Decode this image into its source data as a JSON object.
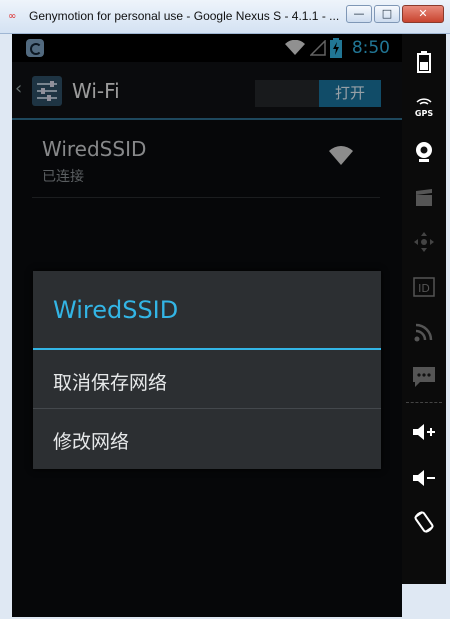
{
  "window": {
    "title": "Genymotion for personal use - Google Nexus S - 4.1.1 - ...",
    "controls": {
      "minimize": "—",
      "maximize": "□",
      "close": "✕"
    }
  },
  "statusbar": {
    "time": "8:50",
    "icons": [
      "app-icon",
      "wifi-icon",
      "no-signal-icon",
      "battery-charging-icon"
    ]
  },
  "actionbar": {
    "title": "Wi-Fi",
    "toggle_label": "打开"
  },
  "network": {
    "name": "WiredSSID",
    "status": "已连接"
  },
  "dialog": {
    "title": "WiredSSID",
    "items": [
      "取消保存网络",
      "修改网络"
    ]
  },
  "sidebar": {
    "buttons": [
      "battery-icon",
      "gps-icon",
      "webcam-icon",
      "video-capture-icon",
      "dpad-icon",
      "id-icon",
      "rss-icon",
      "sms-icon",
      "volume-up-icon",
      "volume-down-icon",
      "rotate-icon"
    ],
    "gps_label": "GPS",
    "id_label": "ID"
  },
  "colors": {
    "accent": "#33b5e5",
    "toggle_on": "#1b75a0",
    "dialog_bg": "#2c2f32",
    "screen_bg": "#0a0c0e"
  }
}
